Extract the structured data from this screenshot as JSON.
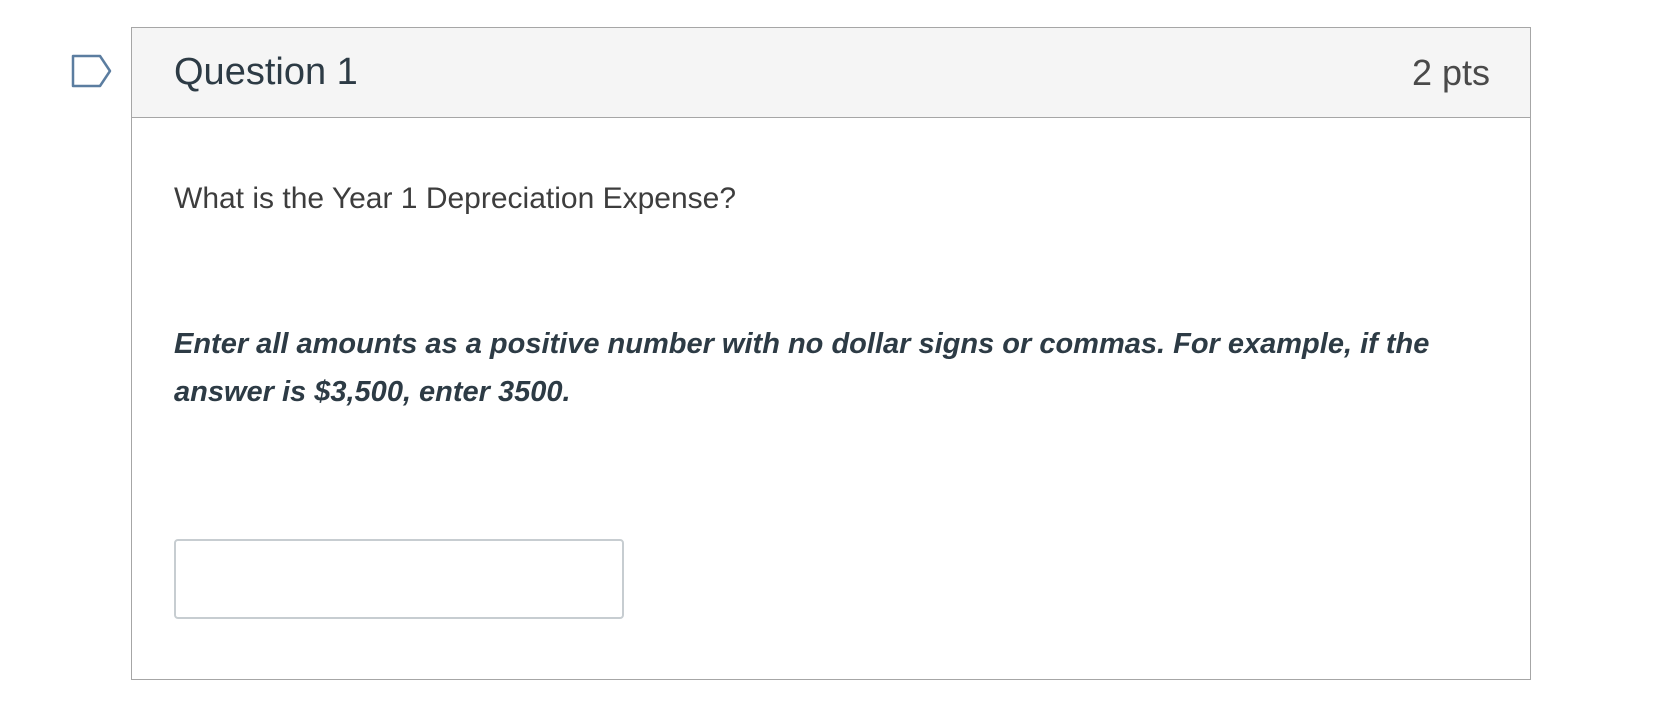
{
  "flag": {
    "icon": "flag-question-icon",
    "color": "#5b7da0"
  },
  "question": {
    "title": "Question 1",
    "points": "2 pts",
    "prompt": "What is the Year 1 Depreciation Expense?",
    "instructions": "Enter all amounts as a positive number with no dollar signs or commas.  For example, if the answer is $3,500, enter 3500.",
    "answer": {
      "value": "",
      "placeholder": ""
    }
  },
  "colors": {
    "header_bg": "#f5f5f5",
    "border": "#a6a6a6",
    "input_border": "#c7cdd1",
    "text_primary": "#2d3b45"
  }
}
